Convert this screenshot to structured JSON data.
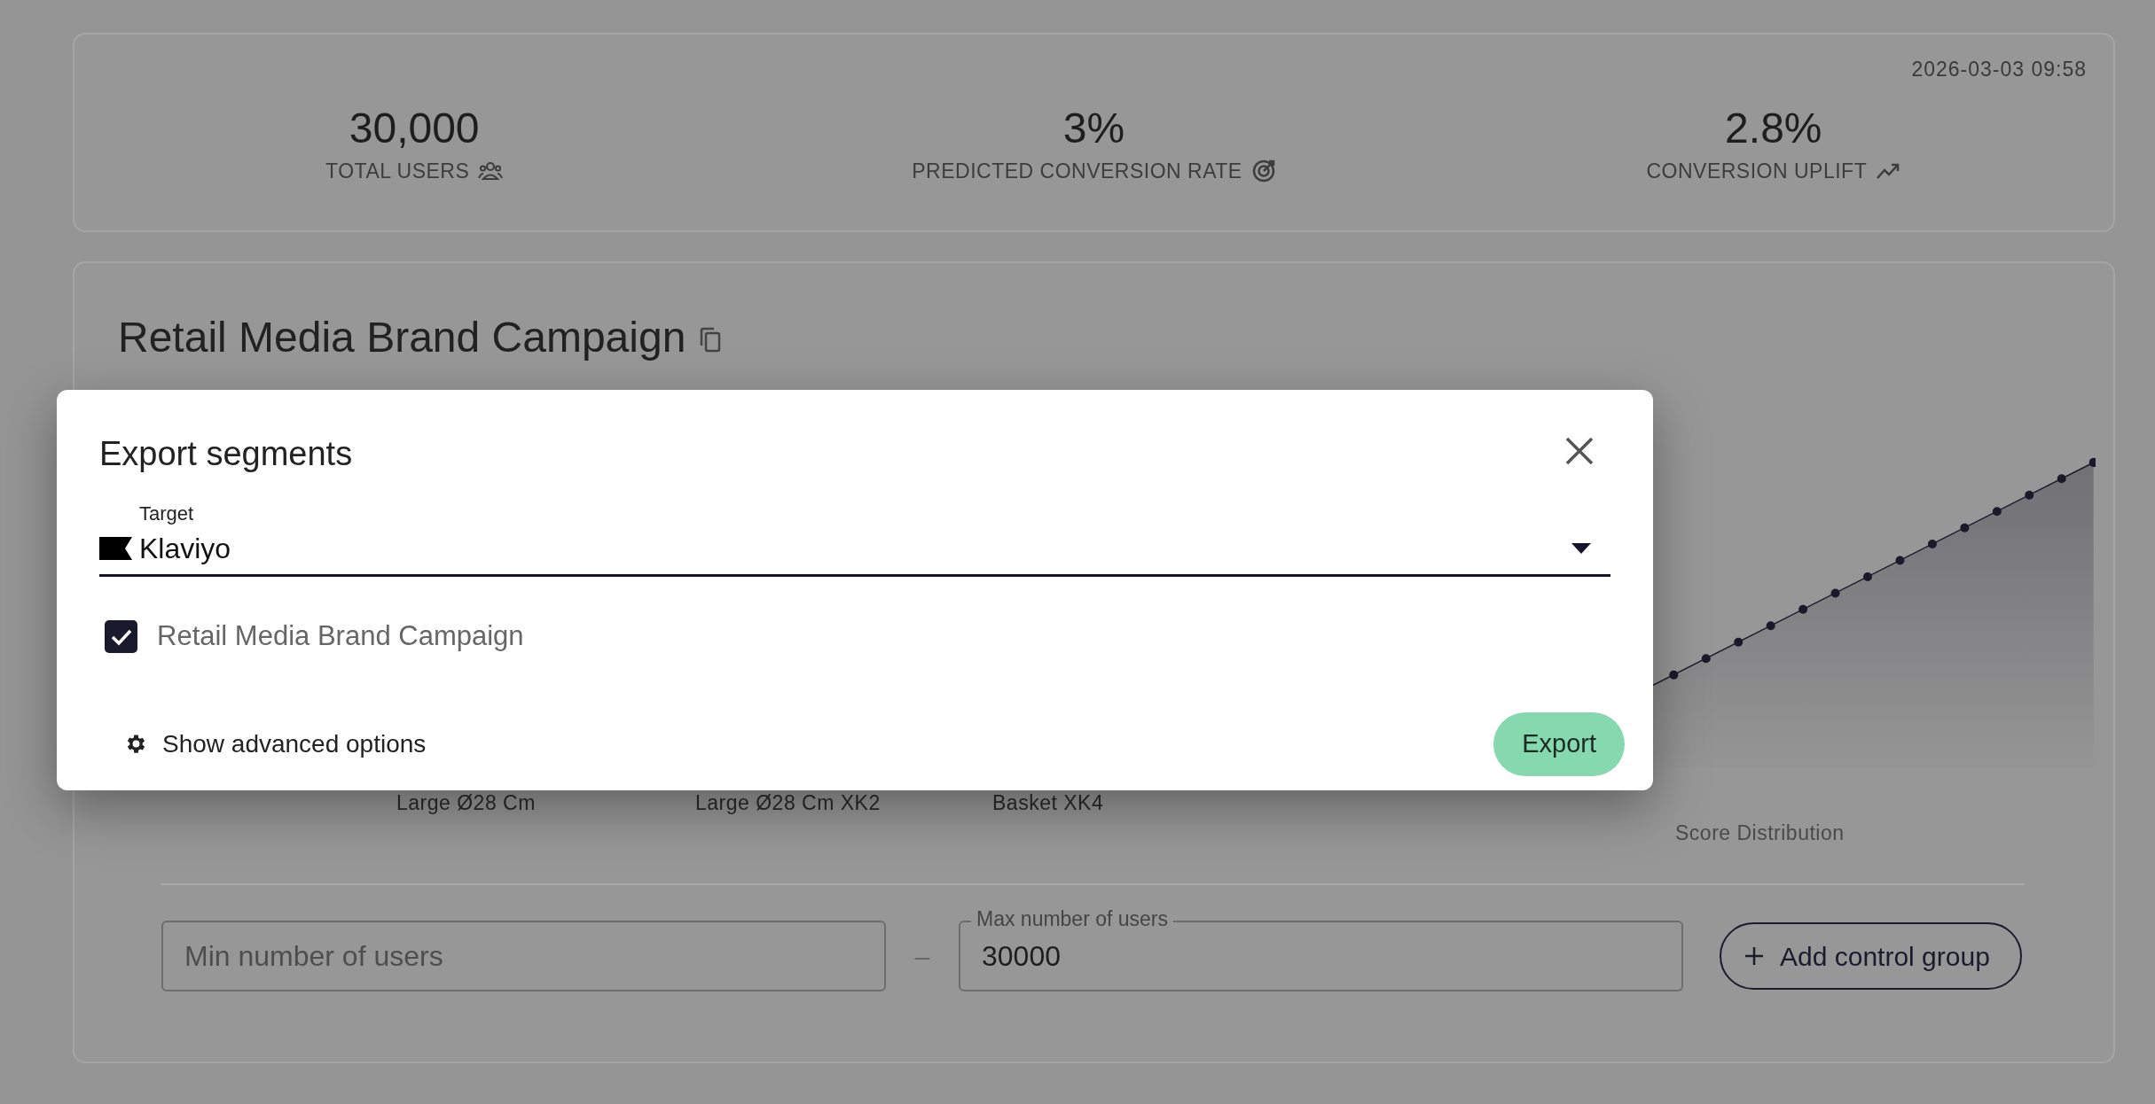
{
  "summary": {
    "timestamp": "2026-03-03 09:58",
    "stats": [
      {
        "value": "30,000",
        "label": "TOTAL USERS",
        "kind": "users"
      },
      {
        "value": "3%",
        "label": "PREDICTED CONVERSION RATE",
        "kind": "target"
      },
      {
        "value": "2.8%",
        "label": "CONVERSION UPLIFT",
        "kind": "trend"
      }
    ]
  },
  "campaign": {
    "title": "Retail Media Brand Campaign",
    "axis_labels": [
      "Large Ø28 Cm",
      "Large Ø28 Cm XK2",
      "Basket XK4"
    ],
    "chart_caption": "Score Distribution",
    "min_field": {
      "placeholder": "Min number of users"
    },
    "separator": "–",
    "max_field": {
      "label": "Max number of users",
      "value": "30000"
    },
    "add_button": "Add control group"
  },
  "modal": {
    "title": "Export segments",
    "target": {
      "label": "Target",
      "value": "Klaviyo"
    },
    "segments": [
      {
        "label": "Retail Media Brand Campaign",
        "checked": true
      }
    ],
    "advanced_link": "Show advanced options",
    "export_button": "Export"
  }
}
